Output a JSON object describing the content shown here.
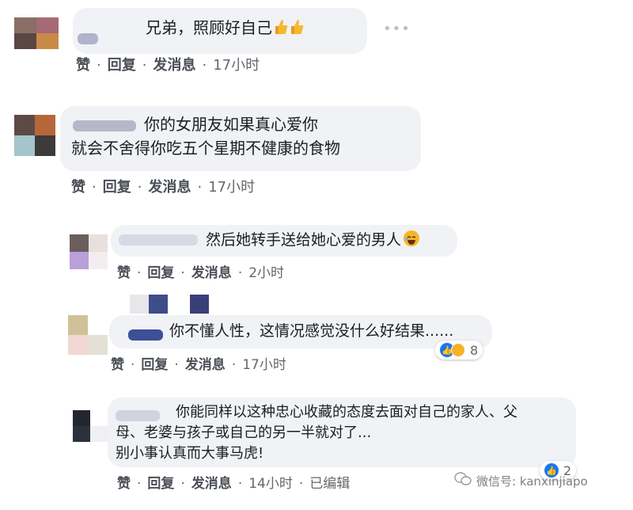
{
  "actions": {
    "like": "赞",
    "reply": "回复",
    "message": "发消息",
    "edited": "已编辑"
  },
  "comments": [
    {
      "text": "兄弟，照顾好自己",
      "time": "17小时"
    },
    {
      "line1": "你的女朋友如果真心爱你",
      "line2": "就会不舍得你吃五个星期不健康的食物",
      "time": "17小时"
    },
    {
      "text": "然后她转手送给她心爱的男人",
      "time": "2小时"
    },
    {
      "text": "你不懂人性，这情况感觉没什么好结果......",
      "time": "17小时",
      "reactions": "8"
    },
    {
      "line1": "你能同样以这种忠心收藏的态度去面对自己的家人、父",
      "line2": "母、老婆与孩子或自己的另一半就对了...",
      "line3": "别小事认真而大事马虎!",
      "time": "14小时",
      "reactions": "2"
    }
  ],
  "watermark": {
    "text": "微信号: kanxinjiapo"
  },
  "colors": {
    "bubble": "#f0f2f5",
    "link": "#4b4f56",
    "like_blue": "#1877f2",
    "thumb_yellow": "#f5b92e"
  }
}
